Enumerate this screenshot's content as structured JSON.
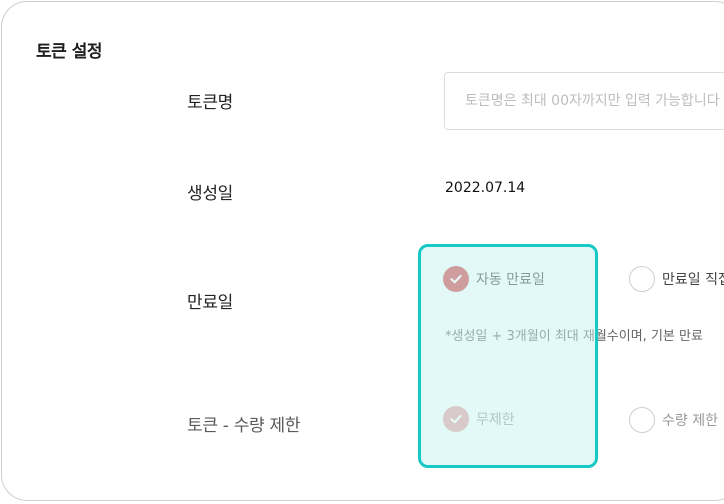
{
  "section": {
    "title": "토큰 설정"
  },
  "token_name": {
    "label": "토큰명",
    "placeholder": "토큰명은 최대 00자까지만 입력 가능합니다"
  },
  "created_date": {
    "label": "생성일",
    "value": "2022.07.14"
  },
  "expiry": {
    "label": "만료일",
    "option_auto": "자동 만료일",
    "option_manual": "만료일 직접",
    "note": "*생성일 + 3개월이 최대 재월수이며, 기본 만료"
  },
  "quantity_limit": {
    "label": "토큰 - 수량 제한",
    "option_unlimited": "무제한",
    "option_limit": "수량 제한"
  },
  "colors": {
    "accent_red": "#d9464f",
    "highlight_border": "#17c9c4",
    "highlight_fill": "#e2f8f6"
  },
  "icons": {
    "checked": "check-icon",
    "unchecked": "empty-radio-icon"
  }
}
